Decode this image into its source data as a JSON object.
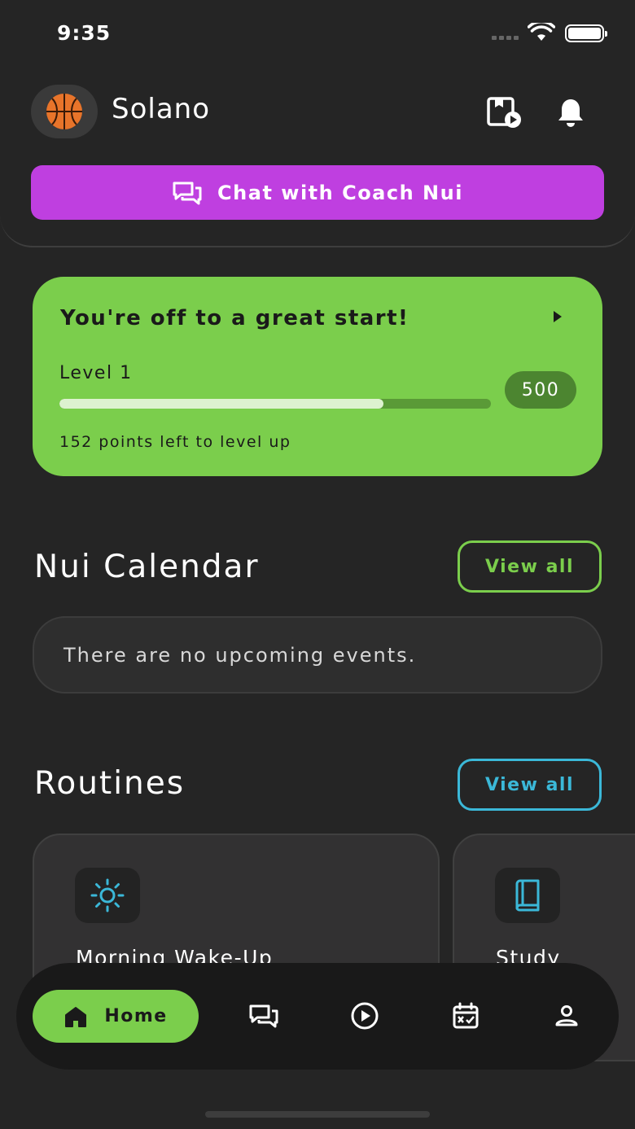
{
  "status_bar": {
    "time": "9:35"
  },
  "header": {
    "username": "Solano",
    "coach_button_label": "Chat with Coach Nui"
  },
  "progress": {
    "headline": "You're off to a great start!",
    "level_label": "Level 1",
    "points": "500",
    "fill_fraction": 0.75,
    "points_left_text": "152 points left to level up",
    "colors": {
      "card": "#7bce4c",
      "fill": "#ddf2cf",
      "track": "#5a9a37"
    }
  },
  "calendar": {
    "title": "Nui Calendar",
    "view_all_label": "View all",
    "empty_message": "There are no upcoming events.",
    "accent": "#7bce4c"
  },
  "routines": {
    "title": "Routines",
    "view_all_label": "View all",
    "accent": "#3bb8d8",
    "items": [
      {
        "name": "Morning Wake-Up",
        "icon": "sun-icon"
      },
      {
        "name": "Study",
        "icon": "book-icon"
      }
    ]
  },
  "bottom_nav": {
    "home_label": "Home",
    "items": [
      "home-icon",
      "chat-icon",
      "play-icon",
      "calendar-icon",
      "profile-icon"
    ]
  }
}
